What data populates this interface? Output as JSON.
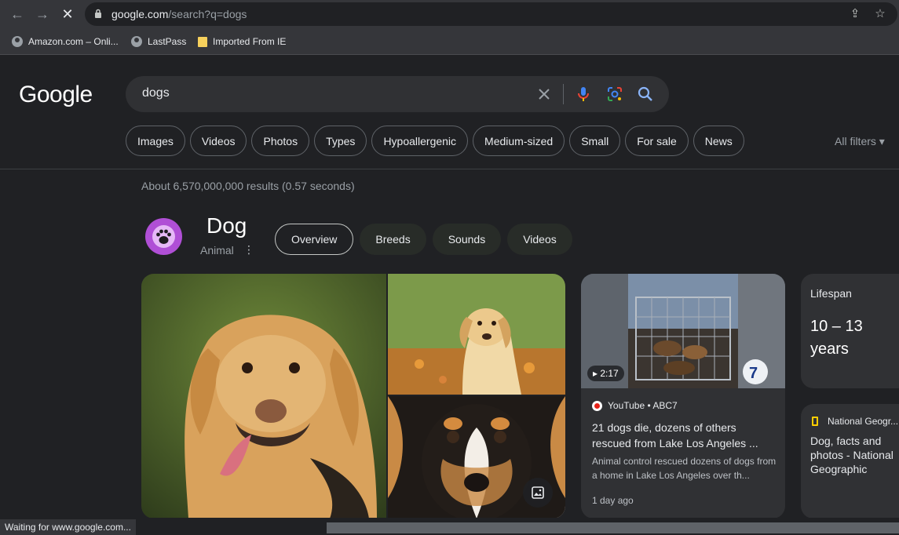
{
  "browser": {
    "url_host": "google.com",
    "url_path": "/search?q=dogs",
    "bookmarks": [
      {
        "label": "Amazon.com – Onli...",
        "icon": "globe-icon"
      },
      {
        "label": "LastPass",
        "icon": "globe-icon"
      },
      {
        "label": "Imported From IE",
        "icon": "folder-icon"
      }
    ],
    "status": "Waiting for www.google.com..."
  },
  "search": {
    "logo": "Google",
    "query": "dogs",
    "chips": [
      "Images",
      "Videos",
      "Photos",
      "Types",
      "Hypoallergenic",
      "Medium-sized",
      "Small",
      "For sale",
      "News"
    ],
    "all_filters": "All filters",
    "results_stats": "About 6,570,000,000 results (0.57 seconds)"
  },
  "knowledge_panel": {
    "title": "Dog",
    "subtitle": "Animal",
    "tabs": [
      "Overview",
      "Breeds",
      "Sounds",
      "Videos"
    ],
    "active_tab": "Overview"
  },
  "video_card": {
    "duration": "2:17",
    "channel_badge": "7",
    "source": "YouTube • ABC7",
    "title": "21 dogs die, dozens of others rescued from Lake Los Angeles ...",
    "description": "Animal control rescued dozens of dogs from a home in Lake Los Angeles over th...",
    "time": "1 day ago"
  },
  "lifespan_card": {
    "label": "Lifespan",
    "value": "10 – 13 years"
  },
  "ng_card": {
    "source": "National Geogr...",
    "title": "Dog, facts and photos - National Geographic"
  },
  "colors": {
    "background": "#202124",
    "chrome": "#35363a",
    "chip_border": "#5f6368",
    "card": "#303134",
    "accent_blue": "#8ab4f8"
  }
}
